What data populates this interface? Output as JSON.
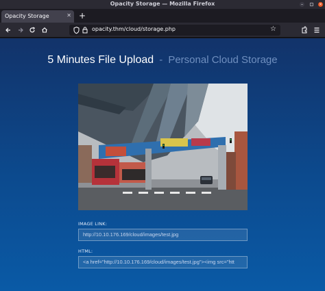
{
  "window": {
    "title": "Opacity Storage — Mozilla Firefox"
  },
  "tabs": [
    {
      "label": "Opacity Storage"
    }
  ],
  "navbar": {
    "url": "opacity.thm/cloud/storage.php"
  },
  "page": {
    "title": "5 Minutes File Upload",
    "separator": "-",
    "subtitle": "Personal Cloud Storage",
    "image_link_label": "IMAGE LINK:",
    "image_link_value": "http://10.10.176.169/cloud/images/test.jpg",
    "html_label": "HTML:",
    "html_value": "<a href=\"http://10.10.176.169/cloud/images/test.jpg\"><img src=\"htt"
  },
  "colors": {
    "accent_close": "#e95420",
    "page_top": "#12336a",
    "page_bottom": "#0a5aa6"
  },
  "icons": [
    "close-icon",
    "plus-icon",
    "back-icon",
    "forward-icon",
    "reload-icon",
    "home-icon",
    "shield-icon",
    "lock-icon",
    "star-icon",
    "extensions-icon",
    "menu-icon"
  ]
}
